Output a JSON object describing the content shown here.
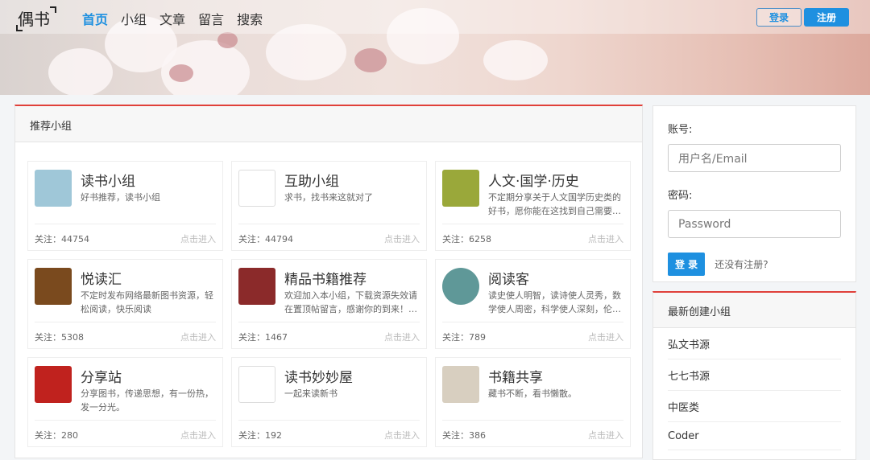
{
  "header": {
    "logo": "偶书",
    "nav": [
      {
        "label": "首页",
        "active": true
      },
      {
        "label": "小组"
      },
      {
        "label": "文章"
      },
      {
        "label": "留言"
      },
      {
        "label": "搜索"
      }
    ],
    "login": "登录",
    "register": "注册"
  },
  "main": {
    "title": "推荐小组",
    "groups": [
      {
        "name": "读书小组",
        "desc": "好书推荐，读书小组",
        "follow": "关注：44754",
        "enter": "点击进入",
        "icon": "book-stack-icon",
        "color": "#9fc7d8"
      },
      {
        "name": "互助小组",
        "desc": "求书，找书来这就对了",
        "follow": "关注：44794",
        "enter": "点击进入",
        "icon": "huzhu-logo-icon",
        "color": "#ffffff"
      },
      {
        "name": "人文·国学·历史",
        "desc": "不定期分享关于人文国学历史类的好书，愿你能在这找到自己需要…",
        "follow": "关注：6258",
        "enter": "点击进入",
        "icon": "bronze-ding-icon",
        "color": "#9aa83a"
      },
      {
        "name": "悦读汇",
        "desc": "不定时发布网络最新图书资源，轻松阅读，快乐阅读",
        "follow": "关注：5308",
        "enter": "点击进入",
        "icon": "open-book-photo-icon",
        "color": "#7a4a1e"
      },
      {
        "name": "精品书籍推荐",
        "desc": "欢迎加入本小组，下载资源失效请在置顶帖留言，感谢你的到来！…",
        "follow": "关注：1467",
        "enter": "点击进入",
        "icon": "jingpin-logo-icon",
        "color": "#8b2a2a"
      },
      {
        "name": "阅读客",
        "desc": "读史使人明智，读诗使人灵秀，数学使人周密，科学使人深刻，伦…",
        "follow": "关注：789",
        "enter": "点击进入",
        "icon": "book-circle-icon",
        "color": "#5f9898"
      },
      {
        "name": "分享站",
        "desc": "分享图书，传递思想，有一份热，发一分光。",
        "follow": "关注：280",
        "enter": "点击进入",
        "icon": "brush-logo-icon",
        "color": "#c0221e"
      },
      {
        "name": "读书妙妙屋",
        "desc": "一起来读新书",
        "follow": "关注：192",
        "enter": "点击进入",
        "icon": "house-icon",
        "color": "#ffffff"
      },
      {
        "name": "书籍共享",
        "desc": "藏书不断，看书懒散。",
        "follow": "关注：386",
        "enter": "点击进入",
        "icon": "books-photo-icon",
        "color": "#d8cfc0"
      }
    ]
  },
  "login": {
    "account_label": "账号:",
    "account_placeholder": "用户名/Email",
    "password_label": "密码:",
    "password_placeholder": "Password",
    "submit": "登 录",
    "register_link": "还没有注册?"
  },
  "new_groups": {
    "title": "最新创建小组",
    "items": [
      "弘文书源",
      "七七书源",
      "中医类",
      "Coder"
    ]
  }
}
